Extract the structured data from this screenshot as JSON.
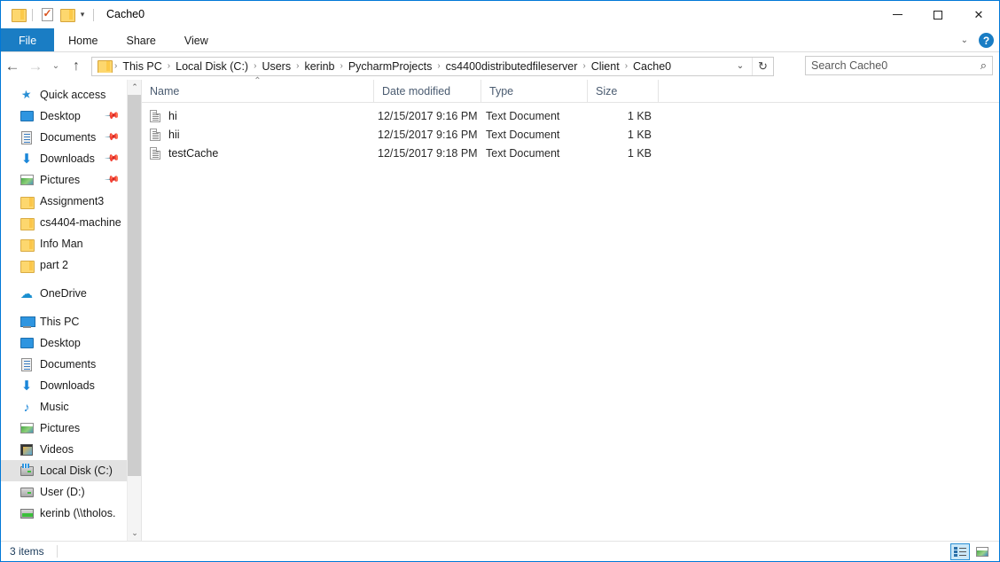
{
  "window": {
    "title": "Cache0",
    "quick_access_toolbar": [
      {
        "name": "folder-icon",
        "label": "Properties folder"
      },
      {
        "name": "properties-icon",
        "label": "Properties"
      },
      {
        "name": "new-folder-icon",
        "label": "New folder"
      },
      {
        "name": "chevron-down-icon",
        "label": "Customize Quick Access Toolbar"
      }
    ],
    "controls": {
      "minimize": "Minimize",
      "maximize": "Maximize",
      "close": "Close"
    }
  },
  "ribbon": {
    "tabs": [
      {
        "label": "File"
      },
      {
        "label": "Home"
      },
      {
        "label": "Share"
      },
      {
        "label": "View"
      }
    ],
    "expand_label": "Expand the Ribbon",
    "help_label": "?"
  },
  "navigation": {
    "back_label": "Back",
    "forward_label": "Forward",
    "recent_label": "Recent locations",
    "up_label": "Up to This PC",
    "refresh_label": "Refresh",
    "dropdown_label": "Previous locations"
  },
  "address": {
    "breadcrumbs": [
      "This PC",
      "Local Disk (C:)",
      "Users",
      "kerinb",
      "PycharmProjects",
      "cs4400distributedfileserver",
      "Client",
      "Cache0"
    ],
    "separator": "›"
  },
  "search": {
    "placeholder": "Search Cache0",
    "value": ""
  },
  "sidebar": {
    "groups": [
      {
        "header": {
          "label": "Quick access",
          "icon": "star-icon"
        },
        "items": [
          {
            "label": "Desktop",
            "icon": "desktop-icon",
            "pinned": true
          },
          {
            "label": "Documents",
            "icon": "documents-icon",
            "pinned": true
          },
          {
            "label": "Downloads",
            "icon": "downloads-icon",
            "pinned": true
          },
          {
            "label": "Pictures",
            "icon": "pictures-icon",
            "pinned": true
          },
          {
            "label": "Assignment3",
            "icon": "folder-icon",
            "pinned": false
          },
          {
            "label": "cs4404-machine",
            "icon": "folder-icon",
            "pinned": false
          },
          {
            "label": "Info Man",
            "icon": "folder-icon",
            "pinned": false
          },
          {
            "label": "part 2",
            "icon": "folder-icon",
            "pinned": false
          }
        ]
      },
      {
        "header": {
          "label": "OneDrive",
          "icon": "onedrive-icon"
        },
        "items": []
      },
      {
        "header": {
          "label": "This PC",
          "icon": "this-pc-icon"
        },
        "items": [
          {
            "label": "Desktop",
            "icon": "desktop-icon",
            "pinned": false
          },
          {
            "label": "Documents",
            "icon": "documents-icon",
            "pinned": false
          },
          {
            "label": "Downloads",
            "icon": "downloads-icon",
            "pinned": false
          },
          {
            "label": "Music",
            "icon": "music-icon",
            "pinned": false
          },
          {
            "label": "Pictures",
            "icon": "pictures-icon",
            "pinned": false
          },
          {
            "label": "Videos",
            "icon": "videos-icon",
            "pinned": false
          },
          {
            "label": "Local Disk (C:)",
            "icon": "system-drive-icon",
            "pinned": false,
            "selected": true
          },
          {
            "label": "User (D:)",
            "icon": "drive-icon",
            "pinned": false
          },
          {
            "label": "kerinb (\\\\tholos.",
            "icon": "network-drive-icon",
            "pinned": false
          }
        ]
      }
    ],
    "selected_color": "#e2e2e2"
  },
  "filelist": {
    "columns": [
      {
        "key": "name",
        "label": "Name",
        "sorted": "asc"
      },
      {
        "key": "date",
        "label": "Date modified",
        "sorted": null
      },
      {
        "key": "type",
        "label": "Type",
        "sorted": null
      },
      {
        "key": "size",
        "label": "Size",
        "sorted": null
      }
    ],
    "rows": [
      {
        "name": "hi",
        "date": "12/15/2017 9:16 PM",
        "type": "Text Document",
        "size": "1 KB",
        "icon": "text-document-icon"
      },
      {
        "name": "hii",
        "date": "12/15/2017 9:16 PM",
        "type": "Text Document",
        "size": "1 KB",
        "icon": "text-document-icon"
      },
      {
        "name": "testCache",
        "date": "12/15/2017 9:18 PM",
        "type": "Text Document",
        "size": "1 KB",
        "icon": "text-document-icon"
      }
    ]
  },
  "statusbar": {
    "item_count": "3 items",
    "views": [
      {
        "name": "details-view",
        "label": "Details view",
        "active": true
      },
      {
        "name": "large-icons-view",
        "label": "Large icons view",
        "active": false
      }
    ]
  },
  "colors": {
    "accent": "#1a7dc4",
    "selection": "#e2e2e2",
    "border": "#e4e4e4",
    "header_text": "#4a5b70",
    "folder": "#fdd76e"
  }
}
